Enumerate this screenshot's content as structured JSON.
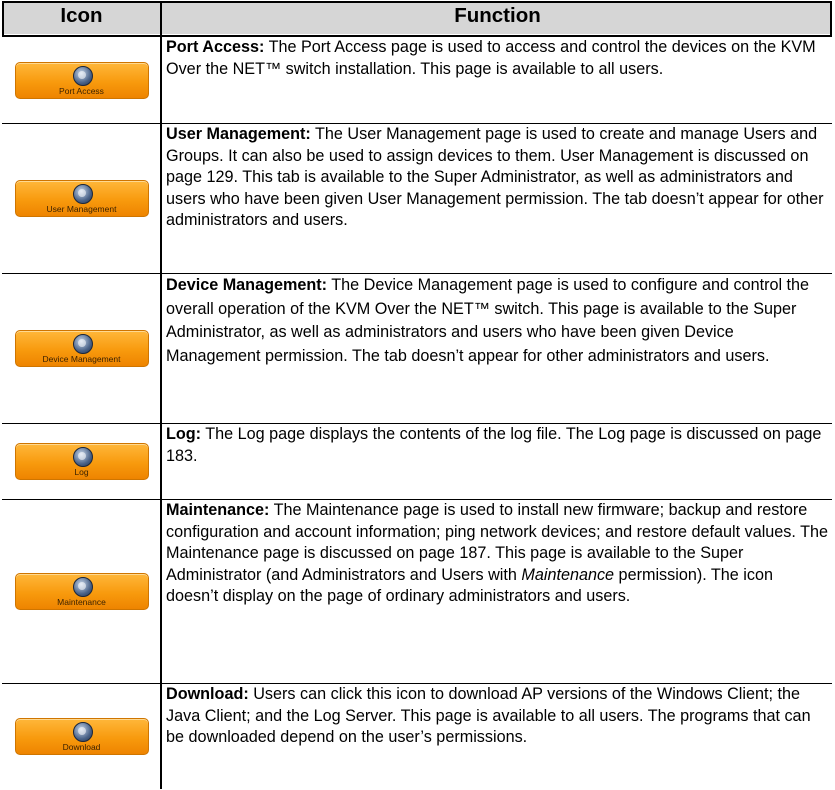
{
  "table": {
    "header": {
      "icon": "Icon",
      "function": "Function"
    },
    "rows": [
      {
        "button_label": "Port Access",
        "icon": "port-access-icon",
        "term": "Port Access:",
        "description": " The Port Access page is used to access and control the devices on the KVM Over the NET™ switch installation. This page is available to all users."
      },
      {
        "button_label": "User Management",
        "icon": "user-management-icon",
        "term": "User Management:",
        "description": " The User Management page is used to create and manage Users and Groups. It can also be used to assign devices to them. User Management is discussed on page 129. This tab is available to the Super Administrator, as well as administrators and users who have been given User Management permission. The tab doesn’t appear for other administrators and users."
      },
      {
        "button_label": "Device Management",
        "icon": "device-management-icon",
        "term": "Device Management:",
        "description": " The Device Management page is used to configure and control the overall operation of the KVM Over the NET™ switch. This page is available to the Super Administrator, as well as administrators and users who have been given Device Management permission. The tab doesn’t appear for other administrators and users."
      },
      {
        "button_label": "Log",
        "icon": "log-icon",
        "term": "Log:",
        "description": " The Log page displays the contents of the log file. The Log page is discussed on page 183."
      },
      {
        "button_label": "Maintenance",
        "icon": "maintenance-icon",
        "term": "Maintenance:",
        "description_before": " The Maintenance page is used to install new firmware; backup and restore configuration and account information; ping network devices; and restore default values. The Maintenance page is discussed on page 187. This page is available to the Super Administrator (and Administrators and Users with ",
        "description_italic": "Maintenance",
        "description_after": " permission). The icon doesn’t display on the page of ordinary administrators and users."
      },
      {
        "button_label": "Download",
        "icon": "download-icon",
        "term": "Download:",
        "description": " Users can click this icon to download AP versions of the Windows Client; the Java Client; and the Log Server. This page is available to all users. The programs that can be downloaded depend on the user’s permissions."
      }
    ]
  }
}
